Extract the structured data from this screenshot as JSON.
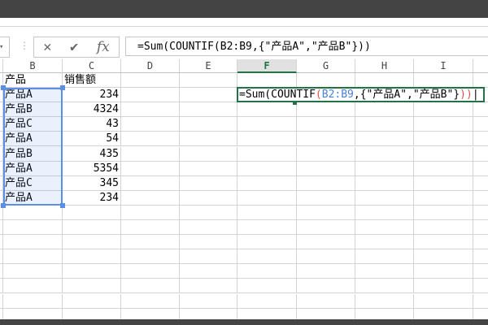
{
  "formula_bar": {
    "cancel_icon": "✕",
    "enter_icon": "✔",
    "fx_label": "fx",
    "formula": "=Sum(COUNTIF(B2:B9,{\"产品A\",\"产品B\"}))"
  },
  "columns": [
    "B",
    "C",
    "D",
    "E",
    "F",
    "G",
    "H",
    "I"
  ],
  "selected_column": "F",
  "header_row": {
    "b": "产品",
    "c": "销售额"
  },
  "rows": [
    {
      "b": "产品A",
      "c": "234"
    },
    {
      "b": "产品B",
      "c": "4324"
    },
    {
      "b": "产品C",
      "c": "43"
    },
    {
      "b": "产品A",
      "c": "54"
    },
    {
      "b": "产品B",
      "c": "435"
    },
    {
      "b": "产品A",
      "c": "5354"
    },
    {
      "b": "产品C",
      "c": "345"
    },
    {
      "b": "产品A",
      "c": "234"
    }
  ],
  "active_cell": {
    "ref": "F2",
    "parts": [
      "=Sum(COUNTIF",
      "(",
      "B2:B9",
      ",{\"产品A\",\"产品B\"}",
      ")",
      ")"
    ]
  }
}
